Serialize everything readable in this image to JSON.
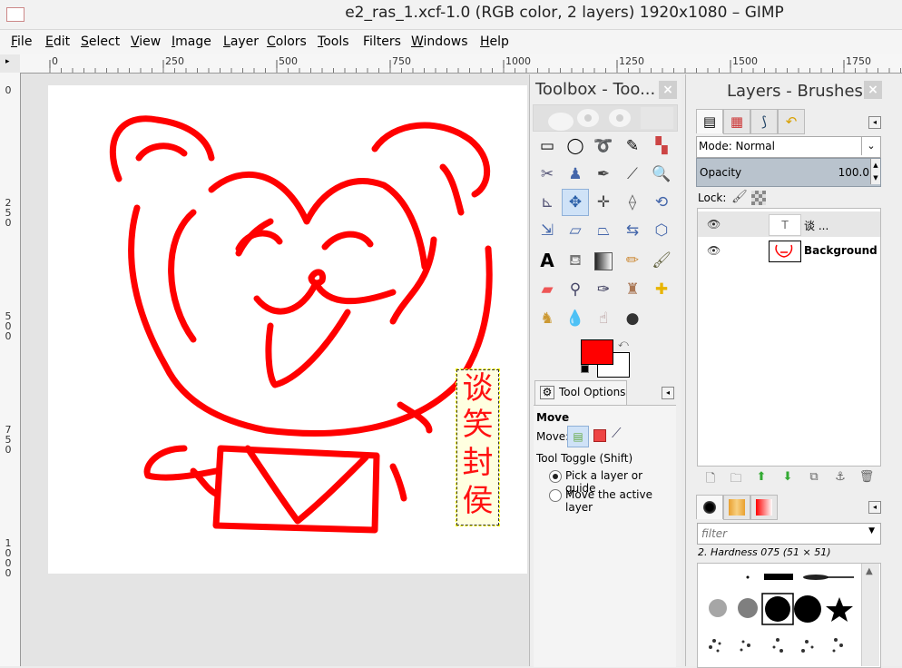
{
  "window": {
    "title": "e2_ras_1.xcf-1.0 (RGB color, 2 layers) 1920x1080 – GIMP"
  },
  "menubar": {
    "items": [
      {
        "label": "File",
        "underline": "F",
        "rest": "ile"
      },
      {
        "label": "Edit",
        "underline": "E",
        "rest": "dit"
      },
      {
        "label": "Select",
        "underline": "S",
        "rest": "elect"
      },
      {
        "label": "View",
        "underline": "V",
        "rest": "iew"
      },
      {
        "label": "Image",
        "underline": "I",
        "rest": "mage"
      },
      {
        "label": "Layer",
        "underline": "L",
        "rest": "ayer"
      },
      {
        "label": "Colors",
        "underline": "C",
        "rest": "olors"
      },
      {
        "label": "Tools",
        "underline": "T",
        "rest": "ools"
      },
      {
        "label": "Filters",
        "underline": "",
        "rest": "Filters"
      },
      {
        "label": "Windows",
        "underline": "W",
        "rest": "indows"
      },
      {
        "label": "Help",
        "underline": "H",
        "rest": "elp"
      }
    ]
  },
  "rulers": {
    "horizontal": [
      "0",
      "250",
      "500",
      "750",
      "1000",
      "1250",
      "1500",
      "1750"
    ],
    "vertical": [
      "0",
      "250",
      "500",
      "750",
      "1000"
    ]
  },
  "canvas": {
    "text_layer_chars": [
      "谈",
      "笑",
      "封",
      "侯"
    ],
    "drawing_color": "#ff0000"
  },
  "toolbox": {
    "title": "Toolbox - Too...",
    "close_icon": "×",
    "tool_options": {
      "tab_label": "Tool Options",
      "tool_name": "Move",
      "move_label": "Move:",
      "toggle_label": "Tool Toggle  (Shift)",
      "option_pick": "Pick a layer or guide",
      "option_move": "Move the active layer"
    },
    "foreground_color": "#ff0000",
    "background_color": "#ffffff"
  },
  "layers_dock": {
    "title": "Layers - Brushes",
    "close_icon": "×",
    "mode_label": "Mode: Normal",
    "opacity_label": "Opacity",
    "opacity_value": "100.0",
    "lock_label": "Lock:",
    "layers": [
      {
        "name": "谈 ...",
        "type": "text",
        "visible": true,
        "selected": true
      },
      {
        "name": "Background",
        "type": "raster",
        "visible": true,
        "selected": false
      }
    ]
  },
  "brushes": {
    "filter_placeholder": "filter",
    "selected_brush": "2. Hardness 075 (51 × 51)"
  }
}
